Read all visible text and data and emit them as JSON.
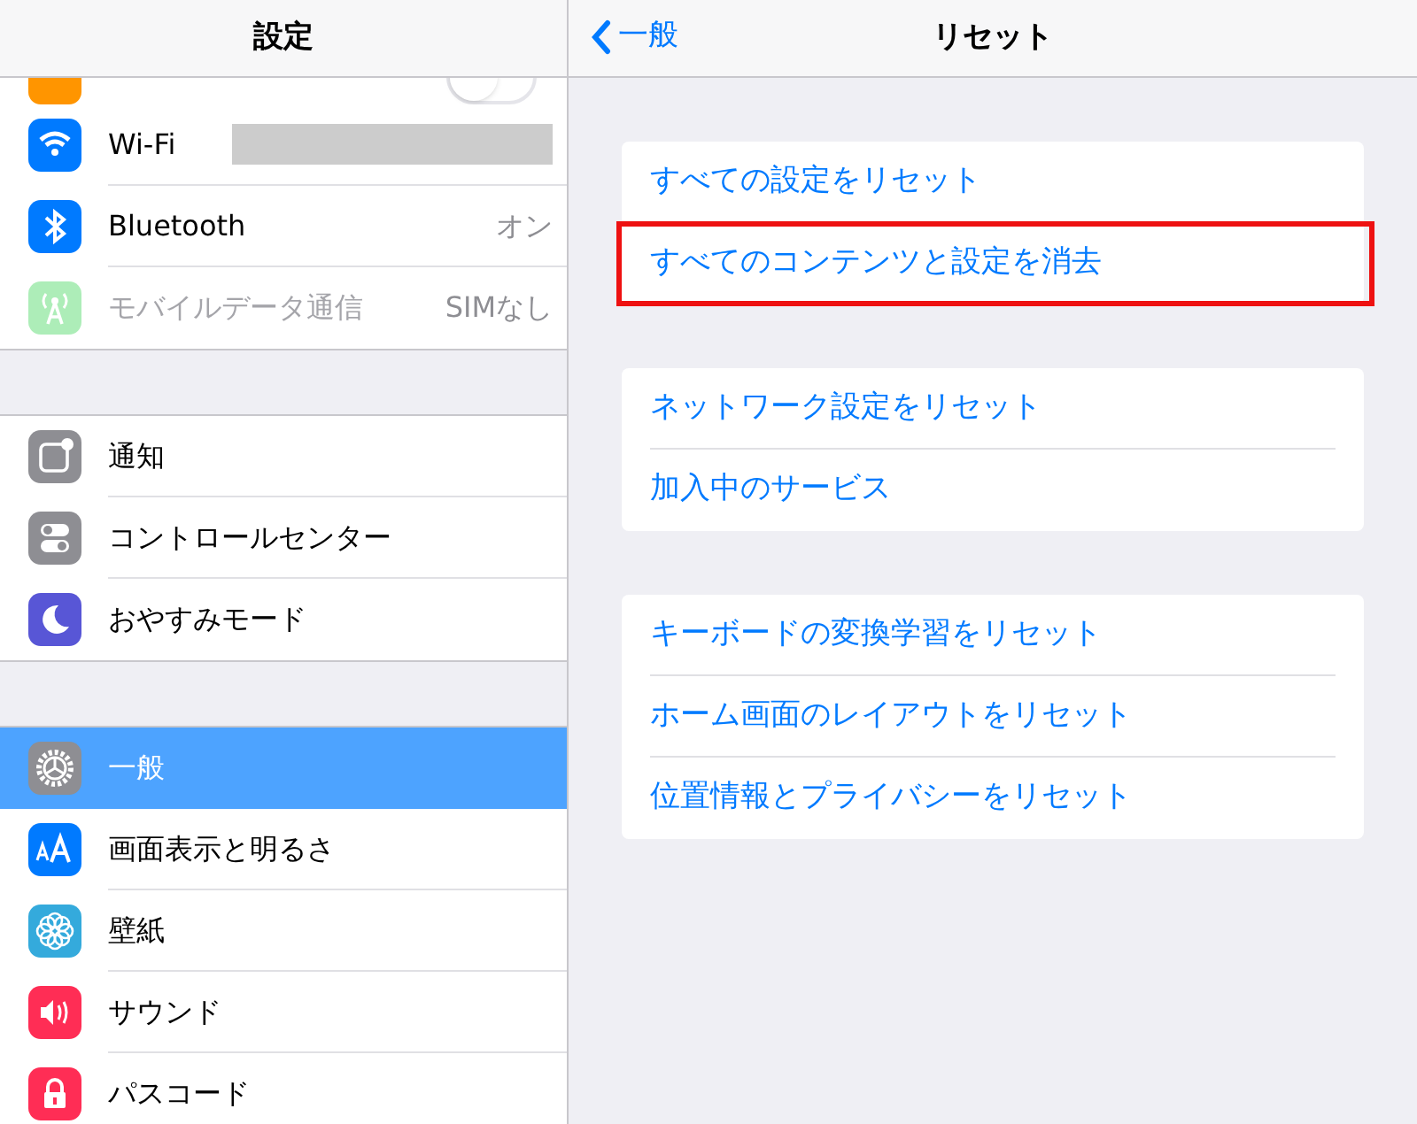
{
  "sidebar": {
    "title": "設定",
    "partial_row": {
      "kind": "orange",
      "toggle_on": false
    },
    "groups": [
      {
        "items": [
          {
            "label": "Wi-Fi",
            "kind": "wifi",
            "value_redacted": true,
            "disabled": false,
            "selected": false
          },
          {
            "label": "Bluetooth",
            "kind": "bluetooth",
            "value": "オン",
            "disabled": false,
            "selected": false
          },
          {
            "label": "モバイルデータ通信",
            "kind": "cellular",
            "value": "SIMなし",
            "disabled": true,
            "selected": false
          }
        ]
      },
      {
        "items": [
          {
            "label": "通知",
            "kind": "notifications",
            "disabled": false,
            "selected": false
          },
          {
            "label": "コントロールセンター",
            "kind": "control",
            "disabled": false,
            "selected": false
          },
          {
            "label": "おやすみモード",
            "kind": "moon",
            "disabled": false,
            "selected": false
          }
        ]
      },
      {
        "items": [
          {
            "label": "一般",
            "kind": "gear",
            "disabled": false,
            "selected": true
          },
          {
            "label": "画面表示と明るさ",
            "kind": "text",
            "disabled": false,
            "selected": false
          },
          {
            "label": "壁紙",
            "kind": "flower",
            "disabled": false,
            "selected": false
          },
          {
            "label": "サウンド",
            "kind": "sound",
            "disabled": false,
            "selected": false
          },
          {
            "label": "パスコード",
            "kind": "lock",
            "disabled": false,
            "selected": false
          }
        ]
      }
    ]
  },
  "detail": {
    "back": "一般",
    "title": "リセット",
    "groups": [
      {
        "items": [
          {
            "label": "すべての設定をリセット",
            "highlighted": false
          },
          {
            "label": "すべてのコンテンツと設定を消去",
            "highlighted": true
          }
        ]
      },
      {
        "items": [
          {
            "label": "ネットワーク設定をリセット",
            "highlighted": false
          },
          {
            "label": "加入中のサービス",
            "highlighted": false
          }
        ]
      },
      {
        "items": [
          {
            "label": "キーボードの変換学習をリセット",
            "highlighted": false
          },
          {
            "label": "ホーム画面のレイアウトをリセット",
            "highlighted": false
          },
          {
            "label": "位置情報とプライバシーをリセット",
            "highlighted": false
          }
        ]
      }
    ]
  }
}
